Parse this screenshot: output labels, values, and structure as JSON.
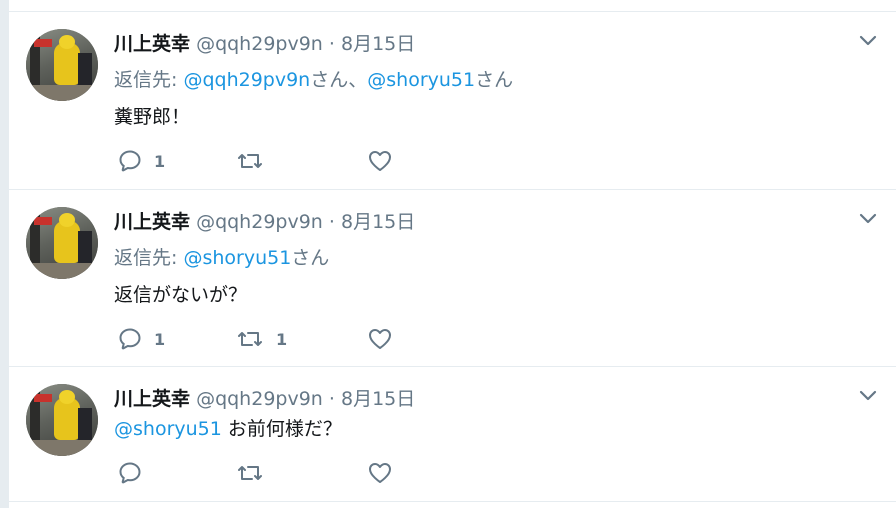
{
  "tweets": [
    {
      "name": "川上英幸",
      "handle": "@qqh29pv9n",
      "dot": "·",
      "date": "8月15日",
      "reply_prefix": "返信先: ",
      "reply_to": [
        {
          "mention": "@qqh29pv9n",
          "suffix": "さん、"
        },
        {
          "mention": "@shoryu51",
          "suffix": "さん"
        }
      ],
      "text": "糞野郎！",
      "reply_count": "1",
      "retweet_count": "",
      "like_count": ""
    },
    {
      "name": "川上英幸",
      "handle": "@qqh29pv9n",
      "dot": "·",
      "date": "8月15日",
      "reply_prefix": "返信先: ",
      "reply_to": [
        {
          "mention": "@shoryu51",
          "suffix": "さん"
        }
      ],
      "text": "返信がないが？",
      "reply_count": "1",
      "retweet_count": "1",
      "like_count": ""
    },
    {
      "name": "川上英幸",
      "handle": "@qqh29pv9n",
      "dot": "·",
      "date": "8月15日",
      "text_mention": "@shoryu51",
      "text": " お前何様だ？",
      "reply_count": "",
      "retweet_count": "",
      "like_count": ""
    }
  ],
  "colors": {
    "link": "#1b95e0",
    "secondary": "#657786",
    "primary": "#14171a",
    "border": "#e6ecf0"
  },
  "icons": [
    "reply-icon",
    "retweet-icon",
    "like-icon",
    "chevron-down-icon"
  ]
}
